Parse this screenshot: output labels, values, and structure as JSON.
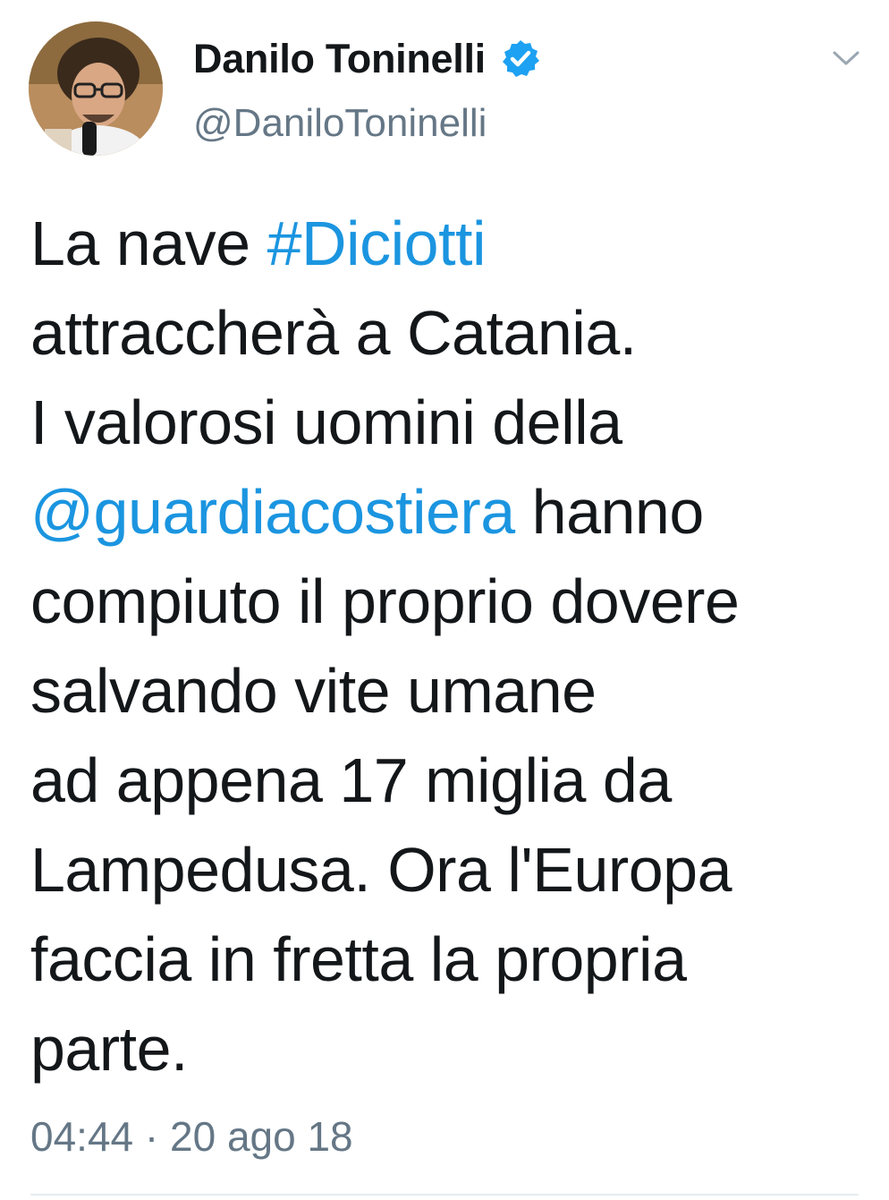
{
  "author": {
    "display_name": "Danilo Toninelli",
    "handle": "@DaniloToninelli",
    "verified": true
  },
  "icons": {
    "verified": "verified-badge-icon",
    "menu": "chevron-down-icon"
  },
  "tweet": {
    "lines": [
      {
        "pre": "La nave ",
        "link": "#Diciotti",
        "post": ""
      },
      {
        "pre": "attraccherà a Catania.",
        "link": "",
        "post": ""
      },
      {
        "pre": "I valorosi uomini della",
        "link": "",
        "post": ""
      },
      {
        "pre": "",
        "link": "@guardiacostiera",
        "post": " hanno"
      },
      {
        "pre": "compiuto il proprio dovere",
        "link": "",
        "post": ""
      },
      {
        "pre": "salvando vite umane",
        "link": "",
        "post": ""
      },
      {
        "pre": "ad appena 17 miglia da",
        "link": "",
        "post": ""
      },
      {
        "pre": "Lampedusa. Ora l'Europa",
        "link": "",
        "post": ""
      },
      {
        "pre": "faccia in fretta la propria",
        "link": "",
        "post": ""
      },
      {
        "pre": "parte.",
        "link": "",
        "post": ""
      }
    ],
    "timestamp": "04:44 · 20 ago 18"
  },
  "colors": {
    "link": "#1b95e0",
    "verified": "#1da1f2",
    "secondary_text": "#657786",
    "text": "#14171a"
  }
}
